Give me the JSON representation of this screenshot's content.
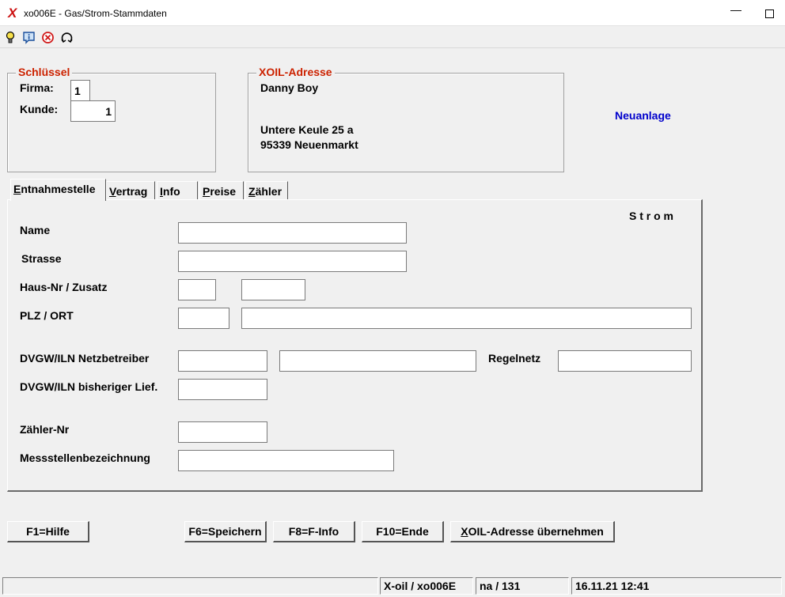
{
  "window": {
    "logo": "X",
    "title": "xo006E - Gas/Strom-Stammdaten",
    "minimize": "—",
    "maximize": ""
  },
  "toolbar": {
    "icons": [
      "lightbulb-icon",
      "info-icon",
      "cancel-icon",
      "exit-icon"
    ]
  },
  "schluessel": {
    "title": "Schlüssel",
    "firma_label": "Firma:",
    "firma_value": "1",
    "kunde_label": "Kunde:",
    "kunde_value": "1"
  },
  "address": {
    "title": "XOIL-Adresse",
    "name": "Danny Boy",
    "street": "Untere Keule 25 a",
    "city": "95339  Neuenmarkt"
  },
  "mode": {
    "text": "Neuanlage",
    "color": "#0000cc"
  },
  "tabs": [
    {
      "first": "E",
      "rest": "ntnahmestelle",
      "active": true
    },
    {
      "first": "V",
      "rest": "ertrag"
    },
    {
      "first": "I",
      "rest": "nfo"
    },
    {
      "first": "P",
      "rest": "reise"
    },
    {
      "first": "Z",
      "rest": "ähler"
    }
  ],
  "panel": {
    "energy_type": "S t r o m",
    "name_label": "Name",
    "name_value": "",
    "strasse_label": "Strasse",
    "strasse_value": "",
    "hausnr_label": "Haus-Nr / Zusatz",
    "hausnr_value": "",
    "zusatz_value": "",
    "plz_label": "PLZ / ORT",
    "plz_value": "",
    "ort_value": "",
    "dvgw_netz_label": "DVGW/ILN Netzbetreiber",
    "dvgw_netz_value": "",
    "netz_name_value": "",
    "regelnetz_label": "Regelnetz",
    "regelnetz_value": "",
    "dvgw_lief_label": "DVGW/ILN bisheriger Lief.",
    "dvgw_lief_value": "",
    "zaehler_label": "Zähler-Nr",
    "zaehler_value": "",
    "messstelle_label": "Messstellenbezeichnung",
    "messstelle_value": ""
  },
  "buttons": {
    "hilfe": "F1=Hilfe",
    "speichern": "F6=Speichern",
    "finfo": "F8=F-Info",
    "ende": "F10=Ende",
    "xoil_first": "X",
    "xoil_rest": "OIL-Adresse übernehmen"
  },
  "status": {
    "program": "X-oil / xo006E",
    "record": "na / 131",
    "datetime": "16.11.21 12:41"
  },
  "colors": {
    "group_title": "#cc2200",
    "logo": "#cc1111"
  }
}
